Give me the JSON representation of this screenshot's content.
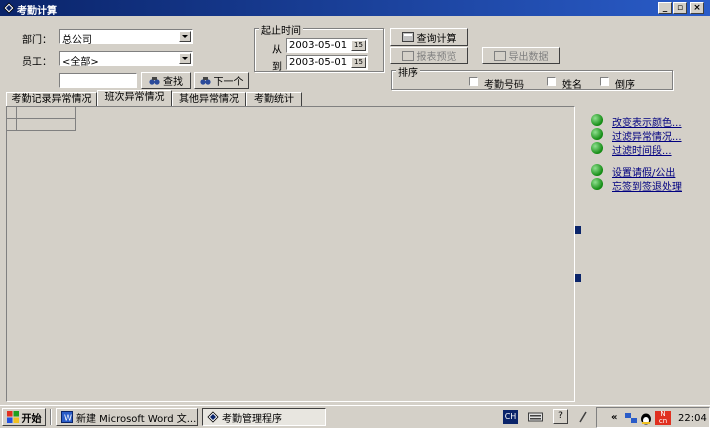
{
  "window": {
    "title": "考勤计算"
  },
  "filters": {
    "dept_label": "部门：",
    "dept_value": "总公司",
    "employee_label": "员工：",
    "employee_value": "<全部>",
    "search_value": "",
    "find_label": "查找",
    "next_label": "下一个"
  },
  "time_range": {
    "group_title": "起止时间",
    "from_label": "从",
    "from_date": "2003-05-01",
    "to_label": "到",
    "to_date": "2003-05-01"
  },
  "actions": {
    "query_label": "查询计算",
    "report_preview_label": "报表预览",
    "export_label": "导出数据"
  },
  "sort": {
    "group_title": "排序",
    "options": [
      "考勤号码",
      "姓名",
      "倒序"
    ]
  },
  "tabs": [
    "考勤记录异常情况",
    "班次异常情况",
    "其他异常情况",
    "考勤统计"
  ],
  "side_links": {
    "group1": [
      "改变表示颜色...",
      "过滤异常情况...",
      "过滤时间段..."
    ],
    "group2": [
      "设置请假/公出",
      "忘签到签退处理"
    ]
  },
  "taskbar": {
    "start_label": "开始",
    "task1": "新建 Microsoft Word 文...",
    "task2": "考勤管理程序",
    "lang": "CH",
    "clock": "22:04"
  },
  "colors": {
    "title_start": "#0a246a",
    "title_end": "#2a5cc8",
    "face": "#d4d0c8",
    "link": "#000080"
  }
}
